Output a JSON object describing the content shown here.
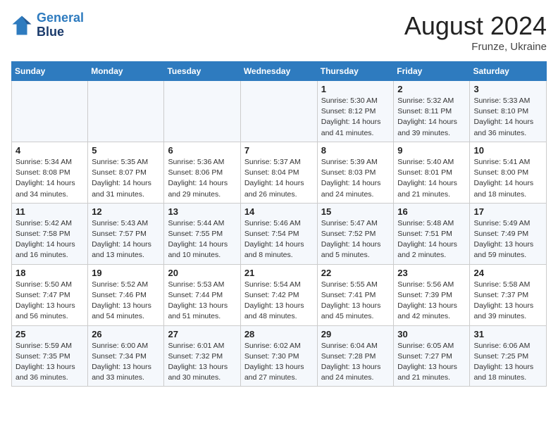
{
  "header": {
    "logo_line1": "General",
    "logo_line2": "Blue",
    "title": "August 2024",
    "location": "Frunze, Ukraine"
  },
  "weekdays": [
    "Sunday",
    "Monday",
    "Tuesday",
    "Wednesday",
    "Thursday",
    "Friday",
    "Saturday"
  ],
  "weeks": [
    [
      {
        "day": "",
        "info": ""
      },
      {
        "day": "",
        "info": ""
      },
      {
        "day": "",
        "info": ""
      },
      {
        "day": "",
        "info": ""
      },
      {
        "day": "1",
        "info": "Sunrise: 5:30 AM\nSunset: 8:12 PM\nDaylight: 14 hours\nand 41 minutes."
      },
      {
        "day": "2",
        "info": "Sunrise: 5:32 AM\nSunset: 8:11 PM\nDaylight: 14 hours\nand 39 minutes."
      },
      {
        "day": "3",
        "info": "Sunrise: 5:33 AM\nSunset: 8:10 PM\nDaylight: 14 hours\nand 36 minutes."
      }
    ],
    [
      {
        "day": "4",
        "info": "Sunrise: 5:34 AM\nSunset: 8:08 PM\nDaylight: 14 hours\nand 34 minutes."
      },
      {
        "day": "5",
        "info": "Sunrise: 5:35 AM\nSunset: 8:07 PM\nDaylight: 14 hours\nand 31 minutes."
      },
      {
        "day": "6",
        "info": "Sunrise: 5:36 AM\nSunset: 8:06 PM\nDaylight: 14 hours\nand 29 minutes."
      },
      {
        "day": "7",
        "info": "Sunrise: 5:37 AM\nSunset: 8:04 PM\nDaylight: 14 hours\nand 26 minutes."
      },
      {
        "day": "8",
        "info": "Sunrise: 5:39 AM\nSunset: 8:03 PM\nDaylight: 14 hours\nand 24 minutes."
      },
      {
        "day": "9",
        "info": "Sunrise: 5:40 AM\nSunset: 8:01 PM\nDaylight: 14 hours\nand 21 minutes."
      },
      {
        "day": "10",
        "info": "Sunrise: 5:41 AM\nSunset: 8:00 PM\nDaylight: 14 hours\nand 18 minutes."
      }
    ],
    [
      {
        "day": "11",
        "info": "Sunrise: 5:42 AM\nSunset: 7:58 PM\nDaylight: 14 hours\nand 16 minutes."
      },
      {
        "day": "12",
        "info": "Sunrise: 5:43 AM\nSunset: 7:57 PM\nDaylight: 14 hours\nand 13 minutes."
      },
      {
        "day": "13",
        "info": "Sunrise: 5:44 AM\nSunset: 7:55 PM\nDaylight: 14 hours\nand 10 minutes."
      },
      {
        "day": "14",
        "info": "Sunrise: 5:46 AM\nSunset: 7:54 PM\nDaylight: 14 hours\nand 8 minutes."
      },
      {
        "day": "15",
        "info": "Sunrise: 5:47 AM\nSunset: 7:52 PM\nDaylight: 14 hours\nand 5 minutes."
      },
      {
        "day": "16",
        "info": "Sunrise: 5:48 AM\nSunset: 7:51 PM\nDaylight: 14 hours\nand 2 minutes."
      },
      {
        "day": "17",
        "info": "Sunrise: 5:49 AM\nSunset: 7:49 PM\nDaylight: 13 hours\nand 59 minutes."
      }
    ],
    [
      {
        "day": "18",
        "info": "Sunrise: 5:50 AM\nSunset: 7:47 PM\nDaylight: 13 hours\nand 56 minutes."
      },
      {
        "day": "19",
        "info": "Sunrise: 5:52 AM\nSunset: 7:46 PM\nDaylight: 13 hours\nand 54 minutes."
      },
      {
        "day": "20",
        "info": "Sunrise: 5:53 AM\nSunset: 7:44 PM\nDaylight: 13 hours\nand 51 minutes."
      },
      {
        "day": "21",
        "info": "Sunrise: 5:54 AM\nSunset: 7:42 PM\nDaylight: 13 hours\nand 48 minutes."
      },
      {
        "day": "22",
        "info": "Sunrise: 5:55 AM\nSunset: 7:41 PM\nDaylight: 13 hours\nand 45 minutes."
      },
      {
        "day": "23",
        "info": "Sunrise: 5:56 AM\nSunset: 7:39 PM\nDaylight: 13 hours\nand 42 minutes."
      },
      {
        "day": "24",
        "info": "Sunrise: 5:58 AM\nSunset: 7:37 PM\nDaylight: 13 hours\nand 39 minutes."
      }
    ],
    [
      {
        "day": "25",
        "info": "Sunrise: 5:59 AM\nSunset: 7:35 PM\nDaylight: 13 hours\nand 36 minutes."
      },
      {
        "day": "26",
        "info": "Sunrise: 6:00 AM\nSunset: 7:34 PM\nDaylight: 13 hours\nand 33 minutes."
      },
      {
        "day": "27",
        "info": "Sunrise: 6:01 AM\nSunset: 7:32 PM\nDaylight: 13 hours\nand 30 minutes."
      },
      {
        "day": "28",
        "info": "Sunrise: 6:02 AM\nSunset: 7:30 PM\nDaylight: 13 hours\nand 27 minutes."
      },
      {
        "day": "29",
        "info": "Sunrise: 6:04 AM\nSunset: 7:28 PM\nDaylight: 13 hours\nand 24 minutes."
      },
      {
        "day": "30",
        "info": "Sunrise: 6:05 AM\nSunset: 7:27 PM\nDaylight: 13 hours\nand 21 minutes."
      },
      {
        "day": "31",
        "info": "Sunrise: 6:06 AM\nSunset: 7:25 PM\nDaylight: 13 hours\nand 18 minutes."
      }
    ]
  ]
}
